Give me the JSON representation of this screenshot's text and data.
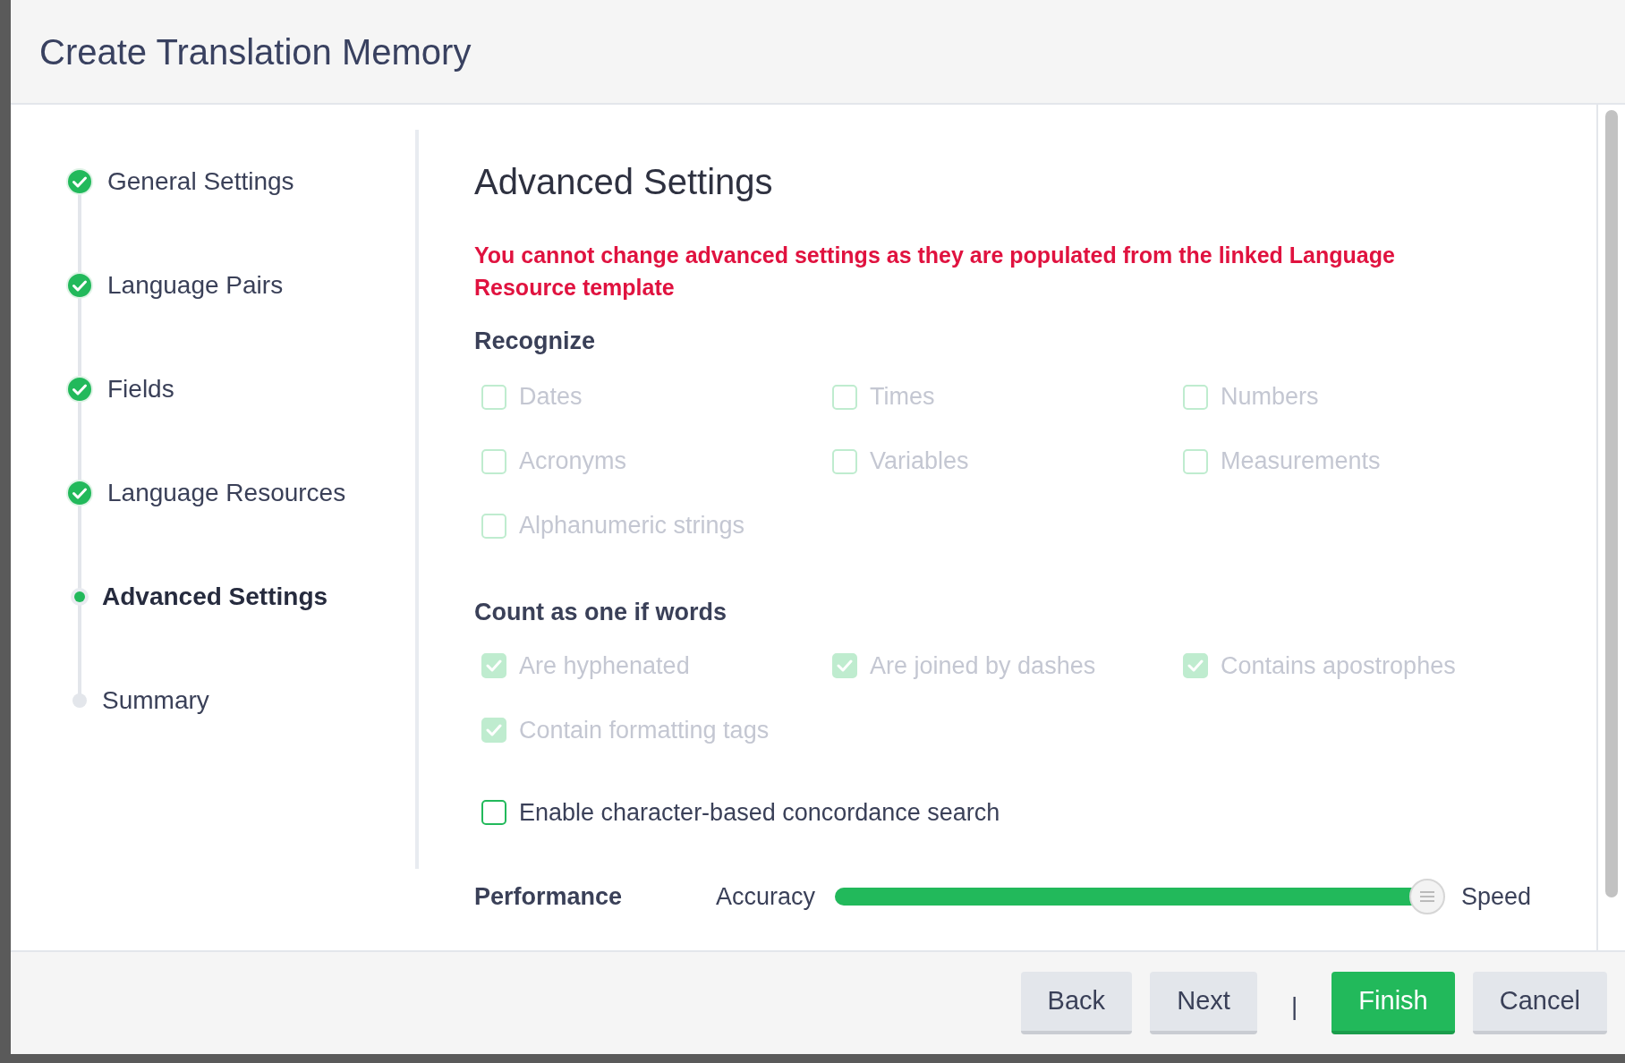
{
  "dialog": {
    "title": "Create Translation Memory"
  },
  "steps": [
    {
      "label": "General Settings",
      "completed": true,
      "selected": false
    },
    {
      "label": "Language Pairs",
      "completed": true,
      "selected": false
    },
    {
      "label": "Fields",
      "completed": true,
      "selected": false
    },
    {
      "label": "Language Resources",
      "completed": true,
      "selected": false
    },
    {
      "label": "Advanced Settings",
      "completed": false,
      "selected": true
    },
    {
      "label": "Summary",
      "completed": false,
      "selected": false
    }
  ],
  "content": {
    "heading": "Advanced Settings",
    "warning": "You cannot change advanced settings as they are populated from the linked Language Resource template",
    "recognize": {
      "title": "Recognize",
      "options": [
        {
          "label": "Dates",
          "checked": false,
          "disabled": true
        },
        {
          "label": "Times",
          "checked": false,
          "disabled": true
        },
        {
          "label": "Numbers",
          "checked": false,
          "disabled": true
        },
        {
          "label": "Acronyms",
          "checked": false,
          "disabled": true
        },
        {
          "label": "Variables",
          "checked": false,
          "disabled": true
        },
        {
          "label": "Measurements",
          "checked": false,
          "disabled": true
        },
        {
          "label": "Alphanumeric strings",
          "checked": false,
          "disabled": true
        }
      ]
    },
    "count_as_one": {
      "title": "Count as one if words",
      "options": [
        {
          "label": "Are hyphenated",
          "checked": true,
          "disabled": true
        },
        {
          "label": "Are joined by dashes",
          "checked": true,
          "disabled": true
        },
        {
          "label": "Contains apostrophes",
          "checked": true,
          "disabled": true
        },
        {
          "label": "Contain formatting tags",
          "checked": true,
          "disabled": true
        }
      ]
    },
    "concordance": {
      "label": "Enable character-based concordance search",
      "checked": false,
      "disabled": false
    },
    "performance": {
      "title": "Performance",
      "min_label": "Accuracy",
      "max_label": "Speed",
      "level": 1
    }
  },
  "footer": {
    "buttons": [
      {
        "label": "Back",
        "kind": "secondary"
      },
      {
        "label": "Next",
        "kind": "secondary"
      },
      {
        "label": "|",
        "kind": "separator"
      },
      {
        "label": "Finish",
        "kind": "primary"
      },
      {
        "label": "Cancel",
        "kind": "secondary"
      }
    ]
  }
}
